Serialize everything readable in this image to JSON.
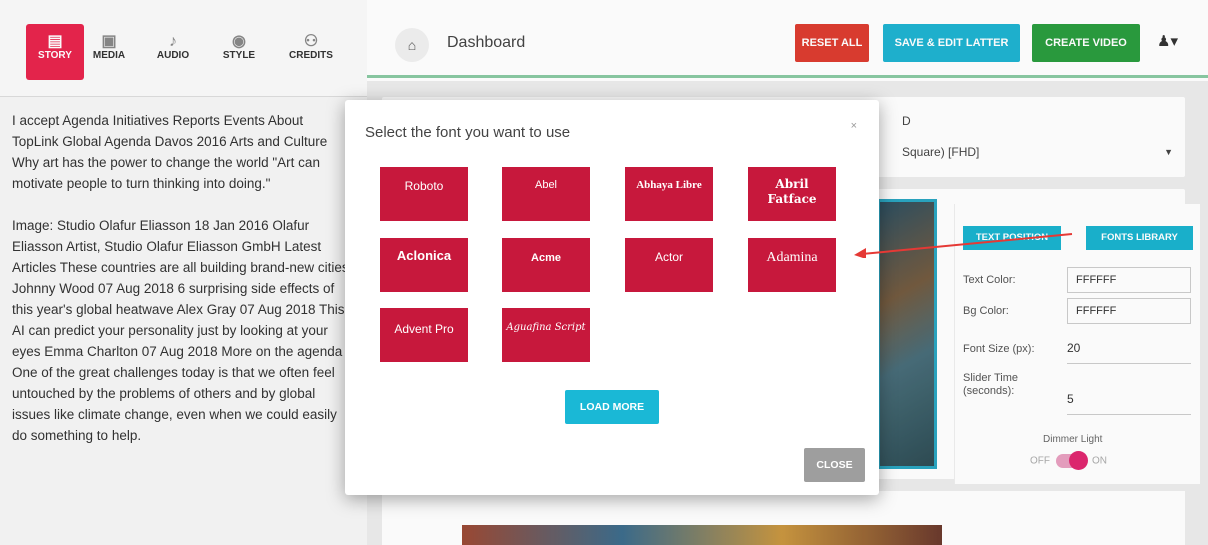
{
  "sidebar": {
    "tabs": [
      {
        "label": "STORY",
        "icon": "story-icon",
        "active": true
      },
      {
        "label": "MEDIA",
        "icon": "media-icon"
      },
      {
        "label": "AUDIO",
        "icon": "music-note-icon"
      },
      {
        "label": "STYLE",
        "icon": "palette-icon"
      },
      {
        "label": "CREDITS",
        "icon": "people-icon"
      }
    ],
    "story_paragraphs": [
      "I accept Agenda Initiatives Reports Events About TopLink Global Agenda Davos 2016 Arts and Culture Why art has the power to change the world \"Art can motivate people to turn thinking into doing.\"",
      "Image: Studio Olafur Eliasson 18 Jan 2016 Olafur Eliasson Artist, Studio Olafur Eliasson GmbH Latest Articles These countries are all building brand-new cities Johnny Wood 07 Aug 2018 6 surprising side effects of this year's global heatwave Alex Gray 07 Aug 2018 This AI can predict your personality just by looking at your eyes Emma Charlton 07 Aug 2018 More on the agenda One of the great challenges today is that we often feel untouched by the problems of others and by global issues like climate change, even when we could easily do something to help."
    ]
  },
  "header": {
    "breadcrumb": "Dashboard",
    "reset_label": "RESET ALL",
    "save_label": "SAVE & EDIT LATTER",
    "create_label": "CREATE VIDEO"
  },
  "main": {
    "resolution_label_fragment": "D",
    "resolution_value": "Square) [FHD]"
  },
  "settings": {
    "text_position_label": "TEXT POSITION",
    "fonts_library_label": "FONTS LIBRARY",
    "text_color_label": "Text Color:",
    "text_color_value": "FFFFFF",
    "bg_color_label": "Bg Color:",
    "bg_color_value": "FFFFFF",
    "font_size_label": "Font Size (px):",
    "font_size_value": "20",
    "slider_time_label": "Slider Time (seconds):",
    "slider_time_value": "5",
    "dimmer_label": "Dimmer Light",
    "off_label": "OFF",
    "on_label": "ON"
  },
  "modal": {
    "title": "Select the font you want to use",
    "close_x": "×",
    "fonts": [
      "Roboto",
      "Abel",
      "Abhaya Libre",
      "Abril Fatface",
      "Aclonica",
      "Acme",
      "Actor",
      "Adamina",
      "Advent Pro",
      "Aguafina Script"
    ],
    "load_more_label": "LOAD MORE",
    "close_label": "CLOSE"
  },
  "colors": {
    "accent_red": "#c7183c",
    "story_tab": "#e8254d",
    "reset": "#dd3d30",
    "save": "#1fb3d1",
    "create": "#2a9d3f",
    "annotation_arrow": "#e53935"
  }
}
